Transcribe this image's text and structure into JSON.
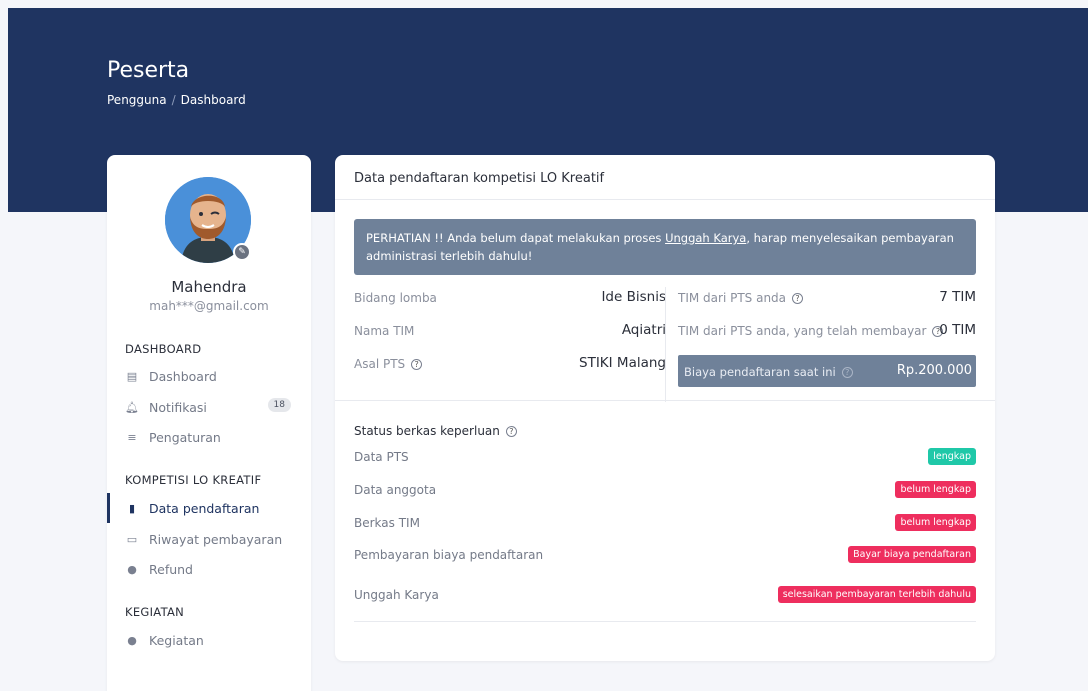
{
  "page": {
    "title": "Peserta",
    "breadcrumb": [
      "Pengguna",
      "/",
      "Dashboard"
    ]
  },
  "colors": {
    "header": "#1f3461",
    "alert": "#6f8199",
    "success": "#1fc8a8",
    "danger": "#ee2e5e"
  },
  "user": {
    "name": "Mahendra",
    "email": "mah***@gmail.com"
  },
  "sidebar": {
    "sections": [
      {
        "title": "DASHBOARD",
        "items": [
          {
            "label": "Dashboard",
            "icon": "dashboard-icon"
          },
          {
            "label": "Notifikasi",
            "icon": "bell-icon",
            "count": "18"
          },
          {
            "label": "Pengaturan",
            "icon": "settings-icon"
          }
        ]
      },
      {
        "title": "KOMPETISI LO KREATIF",
        "items": [
          {
            "label": "Data pendaftaran",
            "icon": "file-icon",
            "active": true
          },
          {
            "label": "Riwayat pembayaran",
            "icon": "credit-card-icon"
          },
          {
            "label": "Refund",
            "icon": "users-icon"
          }
        ]
      },
      {
        "title": "KEGIATAN",
        "items": [
          {
            "label": "Kegiatan",
            "icon": "users-icon"
          }
        ]
      }
    ]
  },
  "card": {
    "title": "Data pendaftaran kompetisi LO Kreatif",
    "alert": {
      "prefix": "PERHATIAN !! Anda belum dapat melakukan proses ",
      "link": "Unggah Karya",
      "suffix": ", harap menyelesaikan pembayaran administrasi terlebih dahulu!"
    },
    "left_info": [
      {
        "label": "Bidang lomba",
        "value": "Ide Bisnis"
      },
      {
        "label": "Nama TIM",
        "value": "Aqiatri"
      },
      {
        "label": "Asal PTS",
        "value": "STIKI Malang",
        "help": "?"
      }
    ],
    "right_info": [
      {
        "label": "TIM dari PTS anda",
        "value": "7 TIM",
        "help": "?"
      },
      {
        "label": "TIM dari PTS anda, yang telah membayar",
        "value": "0 TIM",
        "help": "?"
      }
    ],
    "fee": {
      "label": "Biaya pendaftaran saat ini",
      "value": "Rp.200.000",
      "help": "?"
    },
    "status_title": "Status berkas keperluan",
    "status_help": "?",
    "status_rows": [
      {
        "label": "Data PTS",
        "status": "lengkap",
        "color": "green"
      },
      {
        "label": "Data anggota",
        "status": "belum lengkap",
        "color": "red"
      },
      {
        "label": "Berkas TIM",
        "status": "belum lengkap",
        "color": "red"
      },
      {
        "label": "Pembayaran biaya pendaftaran",
        "status": "Bayar biaya pendaftaran",
        "color": "red"
      },
      {
        "label": "Unggah Karya",
        "status": "selesaikan pembayaran terlebih dahulu",
        "color": "red"
      }
    ]
  }
}
